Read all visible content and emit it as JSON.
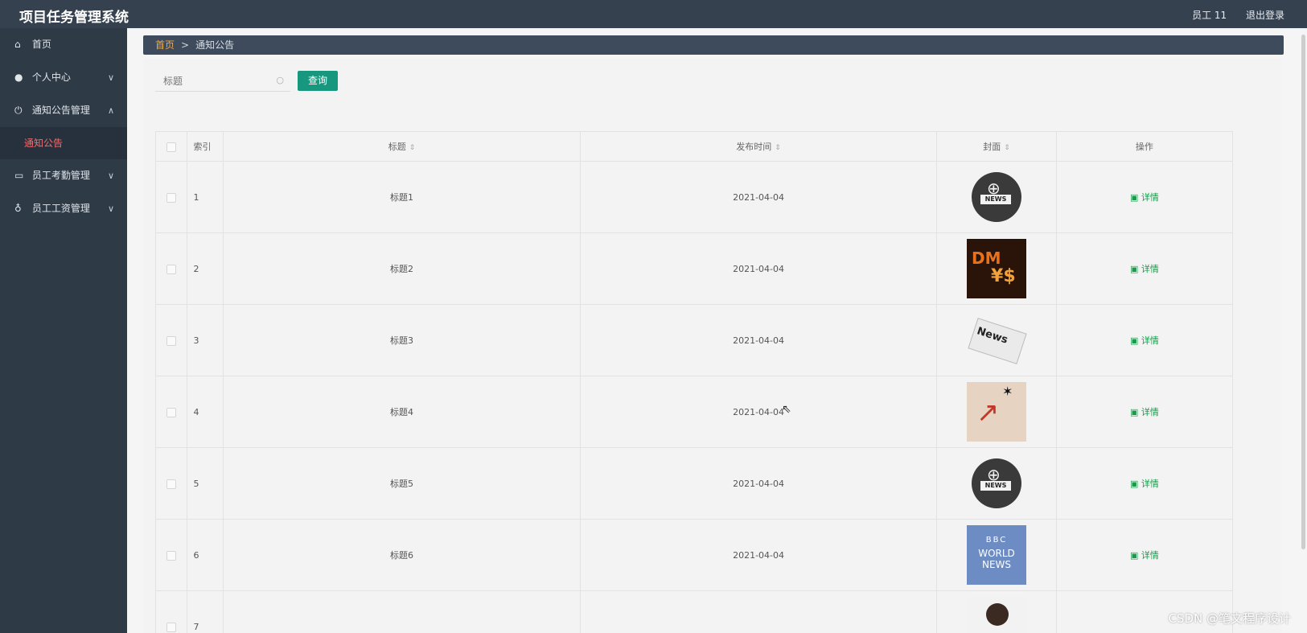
{
  "header": {
    "app_title": "项目任务管理系统",
    "user": "员工 11",
    "logout": "退出登录"
  },
  "sidebar": {
    "items": [
      {
        "label": "首页",
        "icon": "home-icon",
        "expandable": false
      },
      {
        "label": "个人中心",
        "icon": "user-icon",
        "expandable": true,
        "chevron": "down"
      },
      {
        "label": "通知公告管理",
        "icon": "power-icon",
        "expandable": true,
        "chevron": "up"
      },
      {
        "label": "员工考勤管理",
        "icon": "keyboard-icon",
        "expandable": true,
        "chevron": "down"
      },
      {
        "label": "员工工资管理",
        "icon": "microphone-icon",
        "expandable": true,
        "chevron": "down"
      }
    ],
    "subitems": [
      {
        "label": "通知公告",
        "active": true,
        "accent": "#f56c6c"
      }
    ]
  },
  "breadcrumb": {
    "home": "首页",
    "separator": ">",
    "current": "通知公告"
  },
  "search": {
    "placeholder": "标题",
    "button": "查询"
  },
  "table": {
    "columns": [
      "索引",
      "标题",
      "发布时间",
      "封面",
      "操作"
    ],
    "sortable": [
      "标题",
      "发布时间",
      "封面"
    ],
    "rows": [
      {
        "index": "1",
        "title": "标题1",
        "time": "2021-04-04",
        "cover": "news-globe-thumbnail",
        "action": "详情"
      },
      {
        "index": "2",
        "title": "标题2",
        "time": "2021-04-04",
        "cover": "currency-symbols-thumbnail",
        "action": "详情"
      },
      {
        "index": "3",
        "title": "标题3",
        "time": "2021-04-04",
        "cover": "newspaper-thumbnail",
        "action": "详情"
      },
      {
        "index": "4",
        "title": "标题4",
        "time": "2021-04-04",
        "cover": "falling-chart-thumbnail",
        "action": "详情"
      },
      {
        "index": "5",
        "title": "标题5",
        "time": "2021-04-04",
        "cover": "news-globe-thumbnail",
        "action": "详情"
      },
      {
        "index": "6",
        "title": "标题6",
        "time": "2021-04-04",
        "cover": "bbc-world-news-thumbnail",
        "action": "详情"
      },
      {
        "index": "7",
        "title": "",
        "time": "",
        "cover": "portrait-photo-thumbnail",
        "action": ""
      }
    ]
  },
  "colors": {
    "topbar": "#36414f",
    "sidebar": "#2f3a47",
    "primary_button": "#16977e",
    "detail_link": "#1a9a4b",
    "active_menu": "#f56c6c"
  },
  "watermark": "CSDN @笔文程序设计"
}
